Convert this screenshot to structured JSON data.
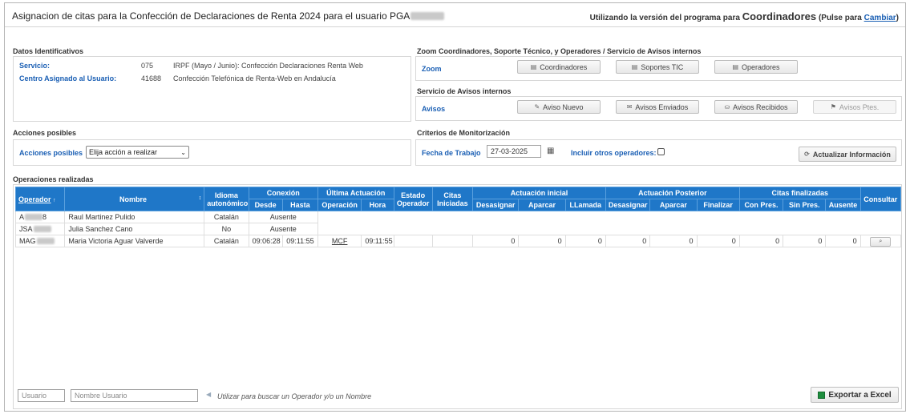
{
  "header": {
    "title": "Asignacion de citas para la Confección de Declaraciones de Renta 2024 para el usuario PGA",
    "version_prefix": "Utilizando la versión del programa para",
    "version_name": "Coordinadores",
    "version_suffix_open": "(Pulse para",
    "version_link": "Cambiar",
    "version_suffix_close": ")"
  },
  "datos": {
    "title": "Datos Identificativos",
    "servicio_label": "Servicio:",
    "servicio_code": "075",
    "servicio_desc": "IRPF (Mayo / Junio): Confección Declaraciones Renta Web",
    "centro_label": "Centro Asignado al Usuario:",
    "centro_code": "41688",
    "centro_desc": "Confección Telefónica de Renta-Web en Andalucía"
  },
  "zoom": {
    "title": "Zoom Coordinadores, Soporte Técnico, y Operadores / Servicio de Avisos internos",
    "label": "Zoom",
    "buttons": [
      "Coordinadores",
      "Soportes TIC",
      "Operadores"
    ]
  },
  "avisos": {
    "title": "Servicio de Avisos internos",
    "label": "Avisos",
    "nuevo": "Aviso Nuevo",
    "enviados": "Avisos Enviados",
    "recibidos": "Avisos Recibidos",
    "ptes": "Avisos Ptes."
  },
  "acciones": {
    "title": "Acciones posibles",
    "label": "Acciones posibles",
    "selected": "Elija acción a realizar"
  },
  "criterios": {
    "title": "Criterios de Monitorización",
    "fecha_label": "Fecha de Trabajo",
    "fecha_value": "27-03-2025",
    "incluir_label": "Incluir otros operadores:",
    "actualizar": "Actualizar Información"
  },
  "operaciones": {
    "title": "Operaciones realizadas",
    "headers": {
      "operador": "Operador",
      "nombre": "Nombre",
      "idioma": "Idioma autonómico",
      "conexion": "Conexión",
      "desde": "Desde",
      "hasta": "Hasta",
      "ultima": "Última Actuación",
      "operacion": "Operación",
      "hora": "Hora",
      "estado": "Estado Operador",
      "citas": "Citas Iniciadas",
      "act_inicial": "Actuación inicial",
      "act_posterior": "Actuación Posterior",
      "citas_fin": "Citas finalizadas",
      "desasignar": "Desasignar",
      "aparcar": "Aparcar",
      "llamada": "LLamada",
      "finalizar": "Finalizar",
      "con_pres": "Con Pres.",
      "sin_pres": "Sin Pres.",
      "ausente": "Ausente",
      "consultar": "Consultar"
    },
    "rows": [
      {
        "op_prefix": "A",
        "op_suffix": "8",
        "nombre": "Raul Martinez Pulido",
        "idioma": "Catalán",
        "conexion": "Ausente"
      },
      {
        "op_prefix": "JSA",
        "op_suffix": "",
        "nombre": "Julia Sanchez Cano",
        "idioma": "No",
        "conexion": "Ausente"
      },
      {
        "op_prefix": "MAG",
        "op_suffix": "",
        "nombre": "Maria Victoria Aguar Valverde",
        "idioma": "Catalán",
        "desde": "09:06:28",
        "hasta": "09:11:55",
        "operacion": "MCF",
        "hora": "09:11:55",
        "ai_desasignar": "0",
        "ai_aparcar": "0",
        "ai_llamada": "0",
        "ap_desasignar": "0",
        "ap_aparcar": "0",
        "ap_finalizar": "0",
        "cf_con": "0",
        "cf_sin": "0",
        "cf_ausente": "0"
      }
    ]
  },
  "bottom": {
    "usuario_placeholder": "Usuario",
    "nombre_placeholder": "Nombre Usuario",
    "hint": "Utilizar para buscar un Operador y/o un Nombre",
    "excel": "Exportar a Excel"
  },
  "colors": {
    "accent": "#1f77c8",
    "link": "#1a5fb4"
  }
}
